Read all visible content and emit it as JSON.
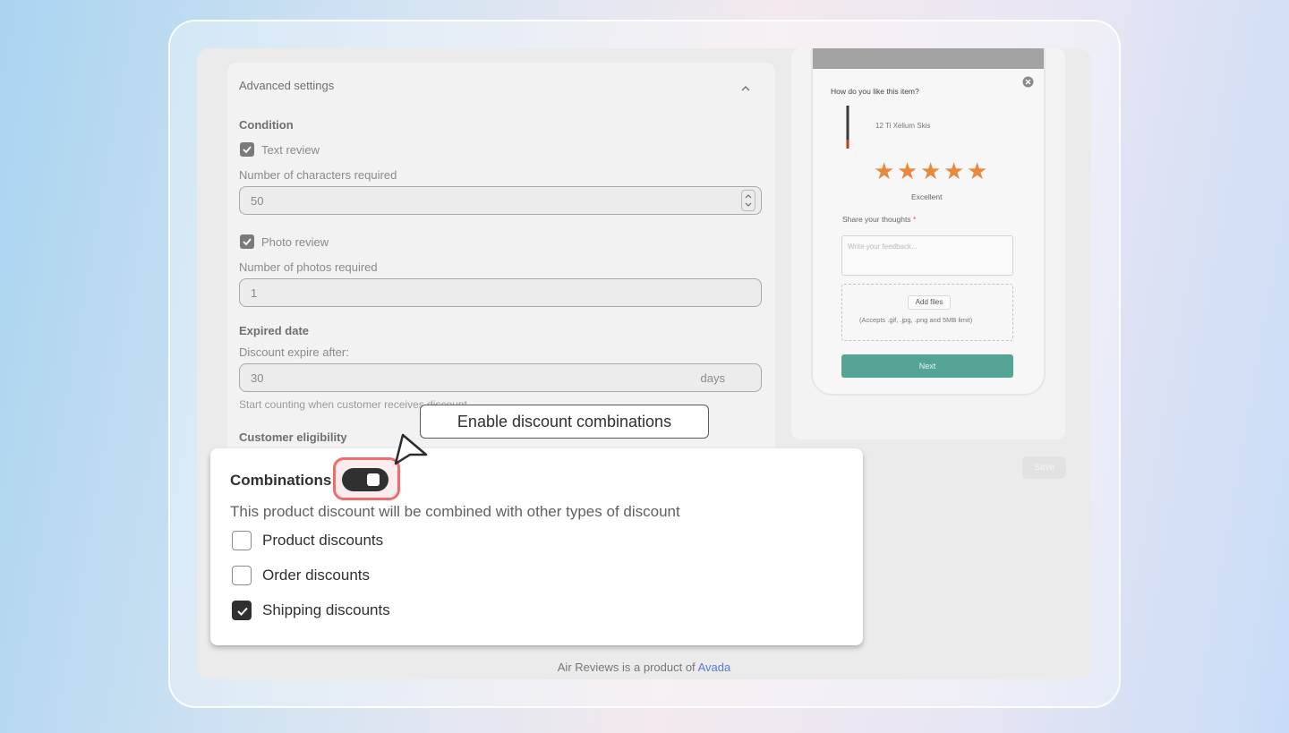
{
  "settings": {
    "title": "Advanced settings",
    "condition_label": "Condition",
    "text_review_label": "Text review",
    "chars_label": "Number of characters required",
    "chars_value": "50",
    "photo_review_label": "Photo review",
    "photos_label": "Number of photos required",
    "photos_value": "1",
    "expired_label": "Expired date",
    "expire_after_label": "Discount expire after:",
    "expire_value": "30",
    "expire_suffix": "days",
    "counting_hint": "Start counting when customer receives discount",
    "eligibility_label": "Customer eligibility"
  },
  "preview": {
    "question": "How do you like this item?",
    "product_name": "12 Ti Xelium Skis",
    "rating": 5,
    "rating_label": "Excellent",
    "thoughts_label": "Share your thoughts",
    "required_mark": "*",
    "feedback_placeholder": "Write your feedback...",
    "add_files_label": "Add files",
    "upload_hint": "(Accepts .gif, .jpg, .png and 5MB limit)",
    "next_label": "Next",
    "accent_color": "#55a597",
    "star_color": "#e8893f"
  },
  "save_label": "Save",
  "footer": {
    "text": "Air Reviews is a product of",
    "link": "Avada"
  },
  "combinations": {
    "title": "Combinations",
    "enabled": true,
    "description": "This product discount will be combined with other types of discount",
    "options": [
      {
        "label": "Product discounts",
        "checked": false
      },
      {
        "label": "Order discounts",
        "checked": false
      },
      {
        "label": "Shipping discounts",
        "checked": true
      }
    ]
  },
  "tooltip": "Enable discount combinations"
}
